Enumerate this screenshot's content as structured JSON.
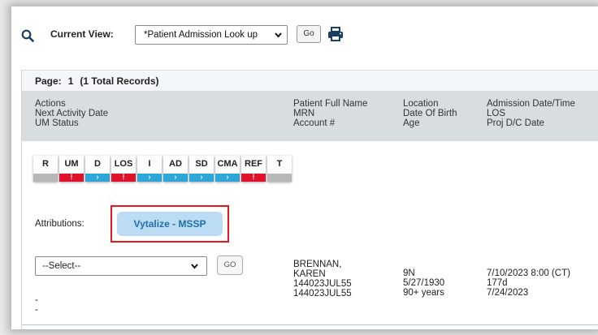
{
  "toolbar": {
    "current_view_label": "Current View:",
    "current_view_value": "*Patient Admission Look up",
    "go_label": "Go"
  },
  "grid": {
    "page_label": "Page:",
    "page_number": "1",
    "total_records": "(1 Total Records)",
    "headers": {
      "col1": [
        "Actions",
        "Next Activity Date",
        "UM Status"
      ],
      "col2": [
        "Patient Full Name",
        "MRN",
        "Account #"
      ],
      "col3": [
        "Location",
        "Date Of Birth",
        "Age"
      ],
      "col4": [
        "Admission Date/Time",
        "LOS",
        "Proj D/C Date"
      ]
    },
    "action_buttons": [
      {
        "label": "R",
        "bar": "gray",
        "glyph": ""
      },
      {
        "label": "UM",
        "bar": "red",
        "glyph": "!"
      },
      {
        "label": "D",
        "bar": "blue",
        "glyph": "›"
      },
      {
        "label": "LOS",
        "bar": "red",
        "glyph": "!"
      },
      {
        "label": "I",
        "bar": "blue",
        "glyph": "›"
      },
      {
        "label": "AD",
        "bar": "blue",
        "glyph": "›"
      },
      {
        "label": "SD",
        "bar": "blue",
        "glyph": "›"
      },
      {
        "label": "CMA",
        "bar": "blue",
        "glyph": "›"
      },
      {
        "label": "REF",
        "bar": "red",
        "glyph": "!"
      },
      {
        "label": "T",
        "bar": "gray",
        "glyph": ""
      }
    ],
    "attributions_label": "Attributions:",
    "attribution_value": "Vytalize - MSSP",
    "row_select_value": "--Select--",
    "row_go_label": "GO",
    "next_activity": "-",
    "um_status": "-",
    "patient": {
      "name_line1": "BRENNAN,",
      "name_line2": "KAREN",
      "mrn": "144023JUL55",
      "account": "144023JUL55"
    },
    "location": {
      "unit": "9N",
      "dob": "5/27/1930",
      "age": "90+ years"
    },
    "admission": {
      "datetime": "7/10/2023 8:00 (CT)",
      "los": "177d",
      "proj_dc": "7/24/2023"
    }
  },
  "colors": {
    "header_bg": "#d8dde0",
    "attr_pill_bg": "#bcdcf3",
    "highlight_border": "#e8181f",
    "status_red": "#e2122b",
    "status_blue": "#2da7d8"
  }
}
